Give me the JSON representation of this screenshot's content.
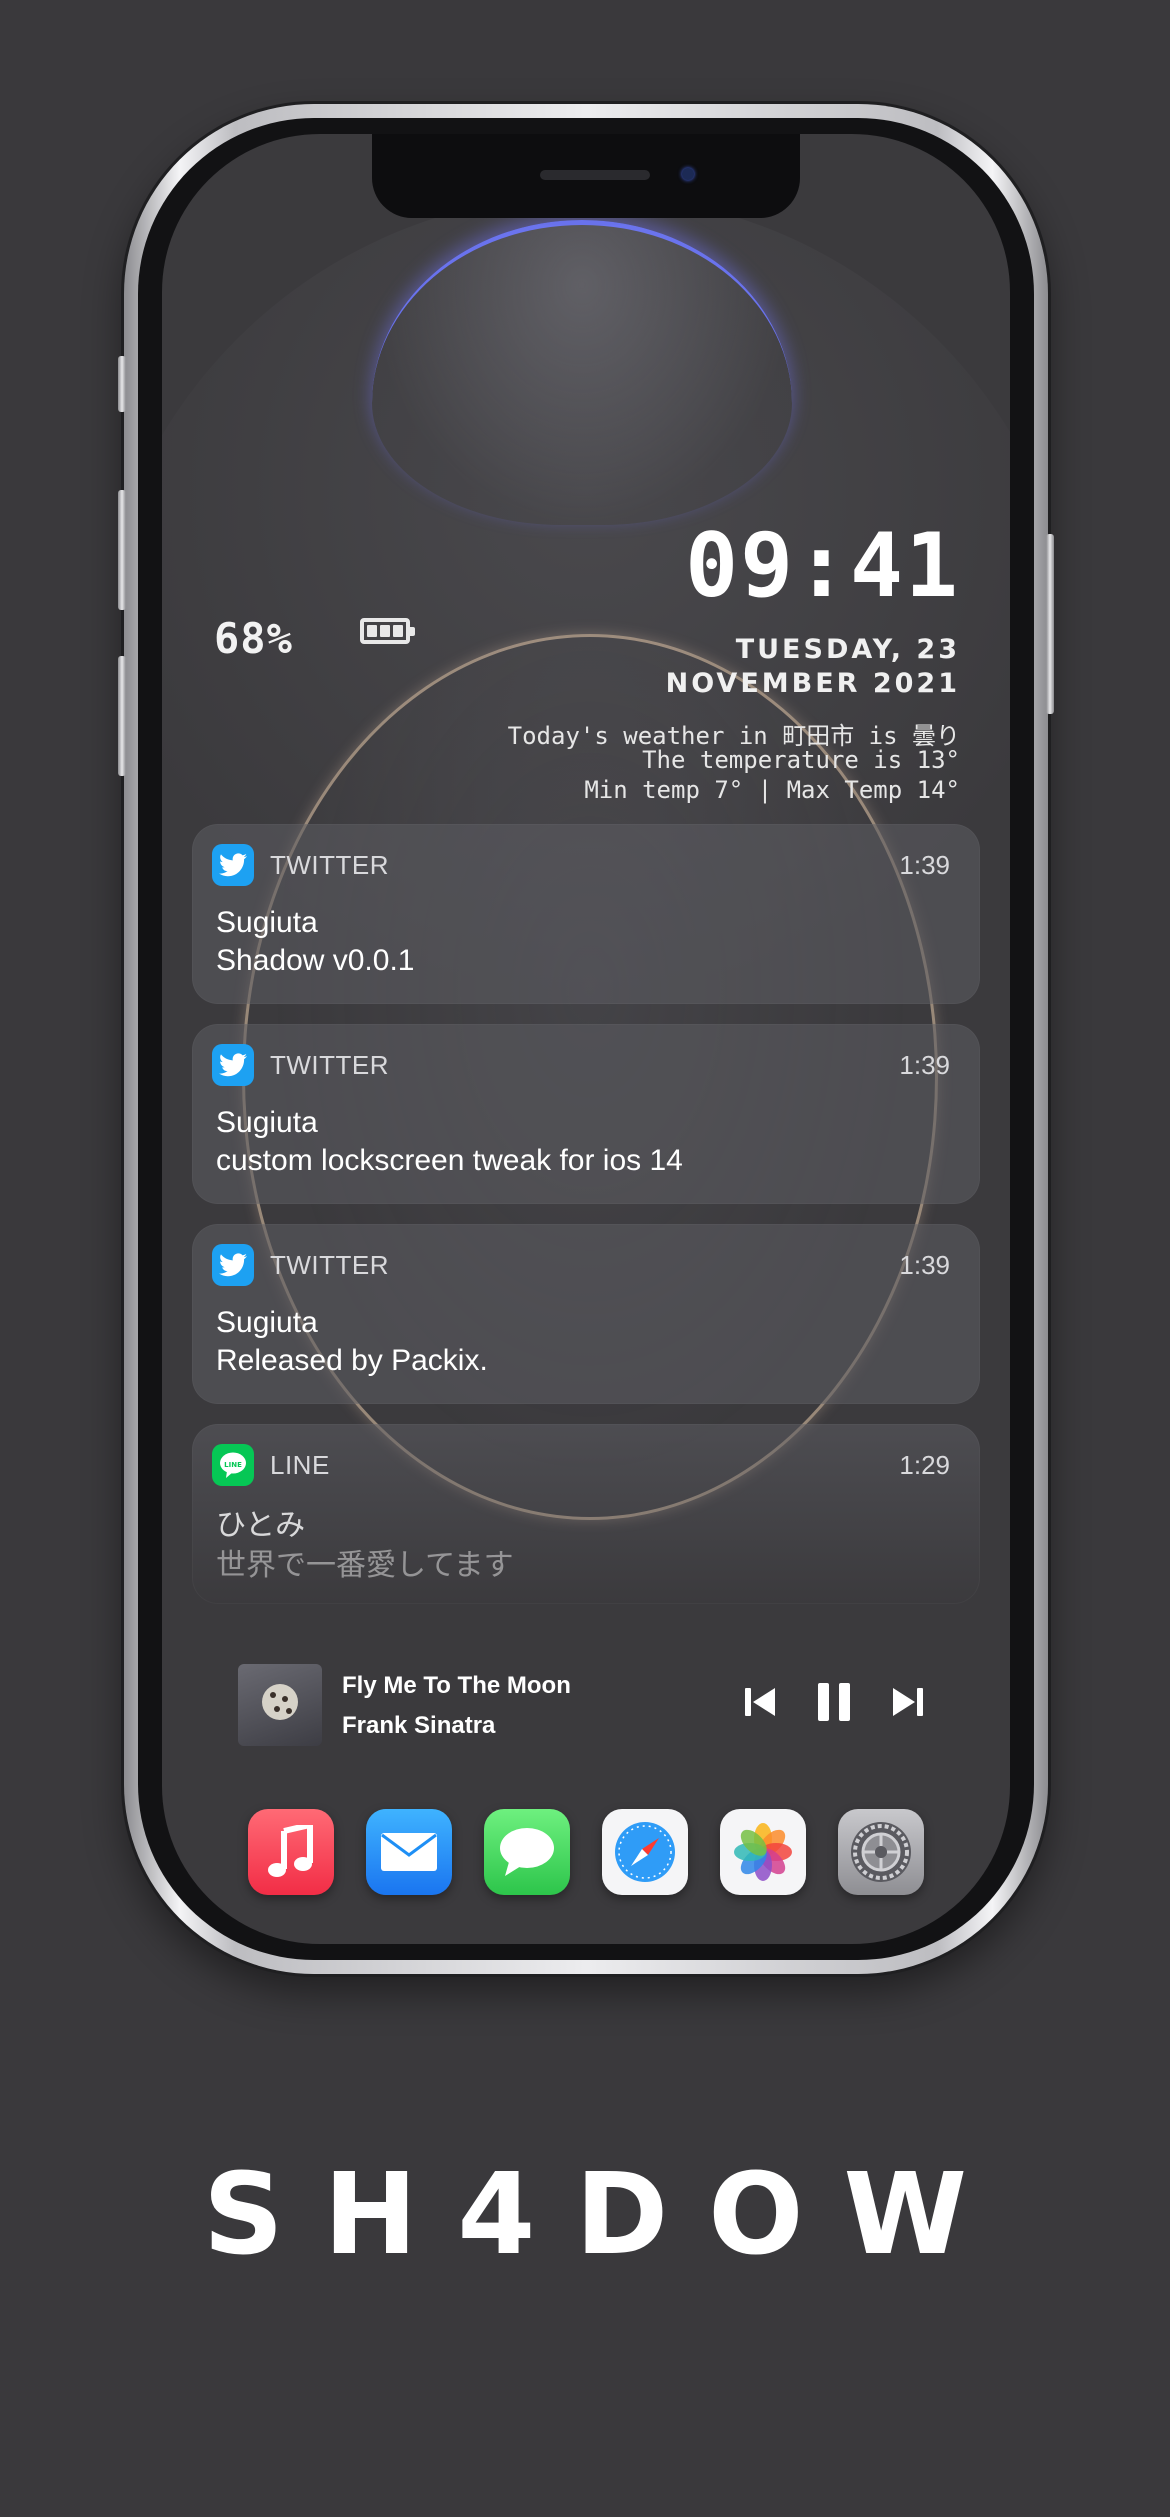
{
  "status": {
    "battery_percent": "68%",
    "battery_level": 1.0
  },
  "lockscreen": {
    "time": "09:41",
    "date_line1": "TUESDAY, 23",
    "date_line2": "NOVEMBER 2021",
    "weather_line1": "Today's weather in 町田市 is 曇り",
    "weather_line2": "The temperature is 13°",
    "weather_line3": "Min temp 7° | Max Temp 14°"
  },
  "notifications": [
    {
      "app": "TWITTER",
      "time": "1:39",
      "title": "Sugiuta",
      "body": "Shadow v0.0.1",
      "icon": "twitter-icon",
      "icon_color": "#1da1f2"
    },
    {
      "app": "TWITTER",
      "time": "1:39",
      "title": "Sugiuta",
      "body": "custom lockscreen tweak for ios 14",
      "icon": "twitter-icon",
      "icon_color": "#1da1f2"
    },
    {
      "app": "TWITTER",
      "time": "1:39",
      "title": "Sugiuta",
      "body": "Released by Packix.",
      "icon": "twitter-icon",
      "icon_color": "#1da1f2"
    },
    {
      "app": "LINE",
      "time": "1:29",
      "title": "ひとみ",
      "body": "世界で一番愛してます",
      "icon": "line-icon",
      "icon_color": "#06c755"
    }
  ],
  "now_playing": {
    "song": "Fly Me To The Moon",
    "artist": "Frank Sinatra"
  },
  "dock": [
    {
      "name": "music-app-icon",
      "color": "#fc3c44"
    },
    {
      "name": "mail-app-icon",
      "color": "#1e8ff5"
    },
    {
      "name": "messages-app-icon",
      "color": "#3fd160"
    },
    {
      "name": "safari-app-icon",
      "color": "#f5f5f7"
    },
    {
      "name": "photos-app-icon",
      "color": "#f5f5f7"
    },
    {
      "name": "settings-app-icon",
      "color": "#8e8e93"
    }
  ],
  "brand": {
    "title": "SH4DOW"
  }
}
